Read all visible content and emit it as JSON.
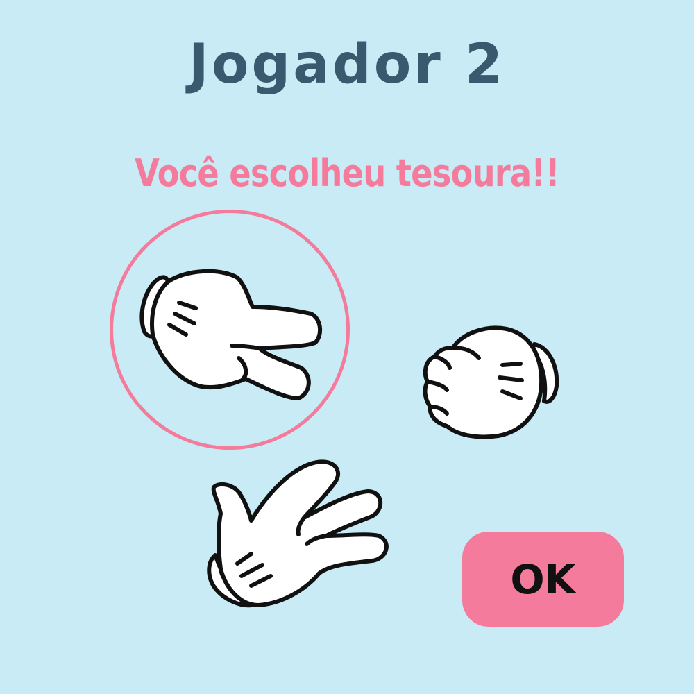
{
  "screen": {
    "background": "#c8ebf5",
    "title": "Jogador 2",
    "message": "Você escolheu tesoura!!"
  },
  "choices": [
    {
      "name": "tesoura",
      "icon": "scissors-hand-icon",
      "selected": true
    },
    {
      "name": "pedra",
      "icon": "rock-fist-icon",
      "selected": false
    },
    {
      "name": "papel",
      "icon": "paper-open-hand-icon",
      "selected": false
    }
  ],
  "ok_button": {
    "label": "OK"
  },
  "colors": {
    "title": "#375a6e",
    "accent": "#f47b9b",
    "glove": "#ffffff",
    "outline": "#111111"
  }
}
